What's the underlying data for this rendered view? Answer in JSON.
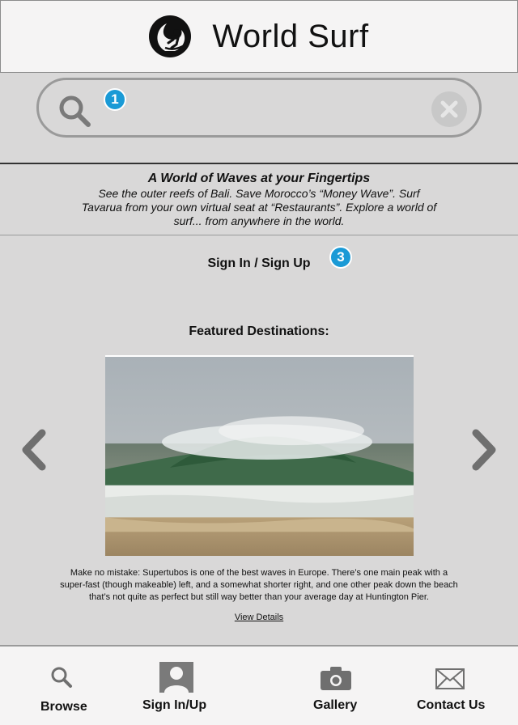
{
  "header": {
    "title": "World Surf",
    "logo_icon": "wave-surfer-logo"
  },
  "search": {
    "placeholder": "",
    "value": "",
    "search_icon": "search-icon",
    "clear_icon": "clear-icon",
    "badge": "1"
  },
  "tagline": {
    "heading": "A World of Waves at your Fingertips",
    "body": "See the outer reefs of Bali. Save Morocco’s “Money Wave”. Surf Tavarua from your own virtual seat at “Restaurants”. Explore a world of surf... from anywhere in the world."
  },
  "main": {
    "signin_label": "Sign In / Sign Up",
    "signin_badge": "3",
    "featured_title": "Featured Destinations:",
    "description": "Make no mistake: Supertubos is one of the best waves in Europe. There’s one main peak with a super-fast (though makeable) left, and a somewhat shorter right, and one other peak down the beach that’s not quite as perfect but still way better than your average day at Huntington Pier.",
    "details_link": "View Details",
    "prev_icon": "chevron-left-icon",
    "next_icon": "chevron-right-icon"
  },
  "tabs": [
    {
      "label": "Browse",
      "icon": "search-icon"
    },
    {
      "label": "Sign In/Up",
      "icon": "user-icon"
    },
    {
      "label": "Gallery",
      "icon": "camera-icon"
    },
    {
      "label": "Contact Us",
      "icon": "mail-icon"
    }
  ],
  "colors": {
    "background": "#d9d8d8",
    "header_bg": "#f5f4f4",
    "badge": "#1a9ad6",
    "icon_gray": "#7a7a7a"
  }
}
